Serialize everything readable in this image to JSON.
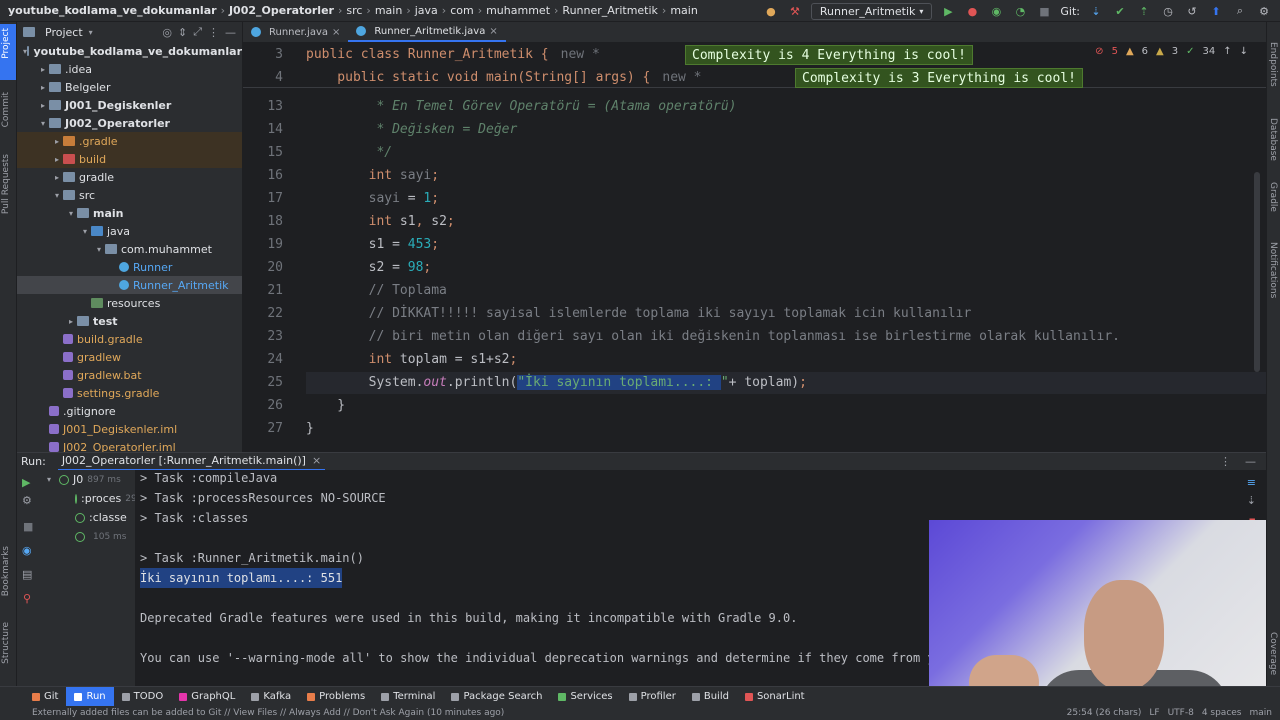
{
  "titlebar": {
    "crumbs": [
      "youtube_kodlama_ve_dokumanlar",
      "J002_Operatorler",
      "src",
      "main",
      "java",
      "com",
      "muhammet",
      "Runner_Aritmetik",
      "main"
    ],
    "run_config": "Runner_Aritmetik",
    "git_label": "Git:"
  },
  "left_stripe": [
    "Project",
    "Commit",
    "Pull Requests",
    "Bookmarks",
    "Structure"
  ],
  "right_stripe": [
    "Endpoints",
    "Database",
    "Gradle",
    "Notifications",
    "Coverage"
  ],
  "project": {
    "header": "Project",
    "items": [
      {
        "label": "youtube_kodlama_ve_dokumanlar",
        "depth": 0,
        "arrow": "▾",
        "icon": "fold",
        "bold": true
      },
      {
        "label": ".idea",
        "depth": 1,
        "arrow": "▸",
        "icon": "fold"
      },
      {
        "label": "Belgeler",
        "depth": 1,
        "arrow": "▸",
        "icon": "fold"
      },
      {
        "label": "J001_Degiskenler",
        "depth": 1,
        "arrow": "▸",
        "icon": "fold",
        "bold": true
      },
      {
        "label": "J002_Operatorler",
        "depth": 1,
        "arrow": "▾",
        "icon": "fold",
        "bold": true
      },
      {
        "label": ".gradle",
        "depth": 2,
        "arrow": "▸",
        "icon": "fold-orange",
        "hl": true,
        "color": "#e0a85a"
      },
      {
        "label": "build",
        "depth": 2,
        "arrow": "▸",
        "icon": "fold-red",
        "hl": true,
        "color": "#e0a85a"
      },
      {
        "label": "gradle",
        "depth": 2,
        "arrow": "▸",
        "icon": "fold"
      },
      {
        "label": "src",
        "depth": 2,
        "arrow": "▾",
        "icon": "fold"
      },
      {
        "label": "main",
        "depth": 3,
        "arrow": "▾",
        "icon": "fold",
        "bold": true
      },
      {
        "label": "java",
        "depth": 4,
        "arrow": "▾",
        "icon": "fold-blue"
      },
      {
        "label": "com.muhammet",
        "depth": 5,
        "arrow": "▾",
        "icon": "fold"
      },
      {
        "label": "Runner",
        "depth": 6,
        "arrow": "",
        "icon": "java",
        "color": "#56a8f5"
      },
      {
        "label": "Runner_Aritmetik",
        "depth": 6,
        "arrow": "",
        "icon": "java",
        "sel": true,
        "color": "#56a8f5"
      },
      {
        "label": "resources",
        "depth": 4,
        "arrow": "",
        "icon": "fold-green"
      },
      {
        "label": "test",
        "depth": 3,
        "arrow": "▸",
        "icon": "fold",
        "bold": true
      },
      {
        "label": "build.gradle",
        "depth": 2,
        "arrow": "",
        "icon": "gradle",
        "color": "#e0a85a"
      },
      {
        "label": "gradlew",
        "depth": 2,
        "arrow": "",
        "icon": "gradle",
        "color": "#e0a85a"
      },
      {
        "label": "gradlew.bat",
        "depth": 2,
        "arrow": "",
        "icon": "gradle",
        "color": "#e0a85a"
      },
      {
        "label": "settings.gradle",
        "depth": 2,
        "arrow": "",
        "icon": "gradle",
        "color": "#e0a85a"
      },
      {
        "label": ".gitignore",
        "depth": 1,
        "arrow": "",
        "icon": "gradle"
      },
      {
        "label": "J001_Degiskenler.iml",
        "depth": 1,
        "arrow": "",
        "icon": "gradle",
        "color": "#e0a85a"
      },
      {
        "label": "J002_Operatorler.iml",
        "depth": 1,
        "arrow": "",
        "icon": "gradle",
        "color": "#e0a85a"
      }
    ]
  },
  "tabs": [
    {
      "label": "Runner.java",
      "active": false
    },
    {
      "label": "Runner_Aritmetik.java",
      "active": true
    }
  ],
  "editor": {
    "sticky": [
      {
        "ln": "3",
        "code": "public class Runner_Aritmetik {",
        "hint": "new *",
        "badge": "Complexity is 4 Everything is cool!"
      },
      {
        "ln": "4",
        "code": "    public static void main(String[] args) {",
        "hint": "new *",
        "badge": "Complexity is 3 Everything is cool!"
      }
    ],
    "warnings": {
      "errors": "5",
      "warns": "6",
      "weak": "3",
      "typos": "34"
    },
    "lines": [
      {
        "ln": "12",
        "segments": [
          {
            "t": "        /**",
            "c": "cmi"
          }
        ]
      },
      {
        "ln": "13",
        "segments": [
          {
            "t": "         * En Temel Görev Operatörü = (Atama operatörü)",
            "c": "cmi"
          }
        ]
      },
      {
        "ln": "14",
        "segments": [
          {
            "t": "         * Değisken = Değer",
            "c": "cmi"
          }
        ]
      },
      {
        "ln": "15",
        "segments": [
          {
            "t": "         */",
            "c": "cmi"
          }
        ]
      },
      {
        "ln": "16",
        "segments": [
          {
            "t": "        ",
            "c": "var"
          },
          {
            "t": "int",
            "c": "kw"
          },
          {
            "t": " sayi",
            "c": "cm"
          },
          {
            "t": ";",
            "c": "kw"
          }
        ]
      },
      {
        "ln": "17",
        "segments": [
          {
            "t": "        sayi",
            "c": "cm"
          },
          {
            "t": " = ",
            "c": "var"
          },
          {
            "t": "1",
            "c": "num"
          },
          {
            "t": ";",
            "c": "kw"
          }
        ]
      },
      {
        "ln": "18",
        "segments": [
          {
            "t": "        ",
            "c": "var"
          },
          {
            "t": "int",
            "c": "kw"
          },
          {
            "t": " s1",
            "c": "var"
          },
          {
            "t": ", ",
            "c": "kw"
          },
          {
            "t": "s2",
            "c": "var"
          },
          {
            "t": ";",
            "c": "kw"
          }
        ]
      },
      {
        "ln": "19",
        "segments": [
          {
            "t": "        s1 = ",
            "c": "var"
          },
          {
            "t": "453",
            "c": "num"
          },
          {
            "t": ";",
            "c": "kw"
          }
        ]
      },
      {
        "ln": "20",
        "segments": [
          {
            "t": "        s2 = ",
            "c": "var"
          },
          {
            "t": "98",
            "c": "num"
          },
          {
            "t": ";",
            "c": "kw"
          }
        ]
      },
      {
        "ln": "21",
        "segments": [
          {
            "t": "        // Toplama",
            "c": "cm"
          }
        ]
      },
      {
        "ln": "22",
        "segments": [
          {
            "t": "        // DİKKAT!!!!! sayisal islemlerde toplama iki sayıyı toplamak icin kullanılır",
            "c": "cm"
          }
        ]
      },
      {
        "ln": "23",
        "segments": [
          {
            "t": "        // biri metin olan diğeri sayı olan iki değiskenin toplanması ise birlestirme olarak kullanılır.",
            "c": "cm"
          }
        ]
      },
      {
        "ln": "24",
        "segments": [
          {
            "t": "        ",
            "c": "var"
          },
          {
            "t": "int",
            "c": "kw"
          },
          {
            "t": " toplam = s1+s2",
            "c": "var"
          },
          {
            "t": ";",
            "c": "kw"
          }
        ]
      },
      {
        "ln": "25",
        "segments": [
          {
            "t": "        System.",
            "c": "var"
          },
          {
            "t": "out",
            "c": "fld"
          },
          {
            "t": ".println(",
            "c": "var"
          },
          {
            "t": "\"İki sayının toplamı....: ",
            "c": "str"
          },
          {
            "t": "\"",
            "c": "str"
          },
          {
            "t": "+ toplam)",
            "c": "var"
          },
          {
            "t": ";",
            "c": "kw"
          }
        ]
      },
      {
        "ln": "26",
        "segments": [
          {
            "t": "    }",
            "c": "var"
          }
        ]
      },
      {
        "ln": "27",
        "segments": [
          {
            "t": "}",
            "c": "var"
          }
        ]
      }
    ]
  },
  "run": {
    "label": "Run:",
    "tab": "J002_Operatorler [:Runner_Aritmetik.main()]",
    "tree": [
      {
        "label": "J0",
        "time": "897 ms"
      },
      {
        "label": ":proces",
        "time": "291 ms"
      },
      {
        "label": ":classe",
        "time": ""
      },
      {
        "label": "",
        "time": "105 ms"
      }
    ],
    "console": [
      "> Task :compileJava",
      "> Task :processResources NO-SOURCE",
      "> Task :classes",
      "",
      "> Task :Runner_Aritmetik.main()",
      "İki sayının toplamı....: 551",
      "",
      "Deprecated Gradle features were used in this build, making it incompatible with Gradle 9.0.",
      "",
      "You can use '--warning-mode all' to show the individual deprecation warnings and determine if they come from y"
    ]
  },
  "toolwindows": [
    {
      "label": "Git",
      "color": "#e87d4a"
    },
    {
      "label": "Run",
      "color": "#ffffff",
      "active": true
    },
    {
      "label": "TODO",
      "color": "#9da0a8"
    },
    {
      "label": "GraphQL",
      "color": "#e535ab"
    },
    {
      "label": "Kafka",
      "color": "#9da0a8"
    },
    {
      "label": "Problems",
      "color": "#e87d4a"
    },
    {
      "label": "Terminal",
      "color": "#9da0a8"
    },
    {
      "label": "Package Search",
      "color": "#9da0a8"
    },
    {
      "label": "Services",
      "color": "#5fb865"
    },
    {
      "label": "Profiler",
      "color": "#9da0a8"
    },
    {
      "label": "Build",
      "color": "#9da0a8"
    },
    {
      "label": "SonarLint",
      "color": "#e05555"
    }
  ],
  "statusbar": {
    "message": "Externally added files can be added to Git // View Files // Always Add // Don't Ask Again (10 minutes ago)",
    "right": [
      "25:54 (26 chars)",
      "LF",
      "UTF-8",
      "4 spaces",
      "main"
    ]
  }
}
